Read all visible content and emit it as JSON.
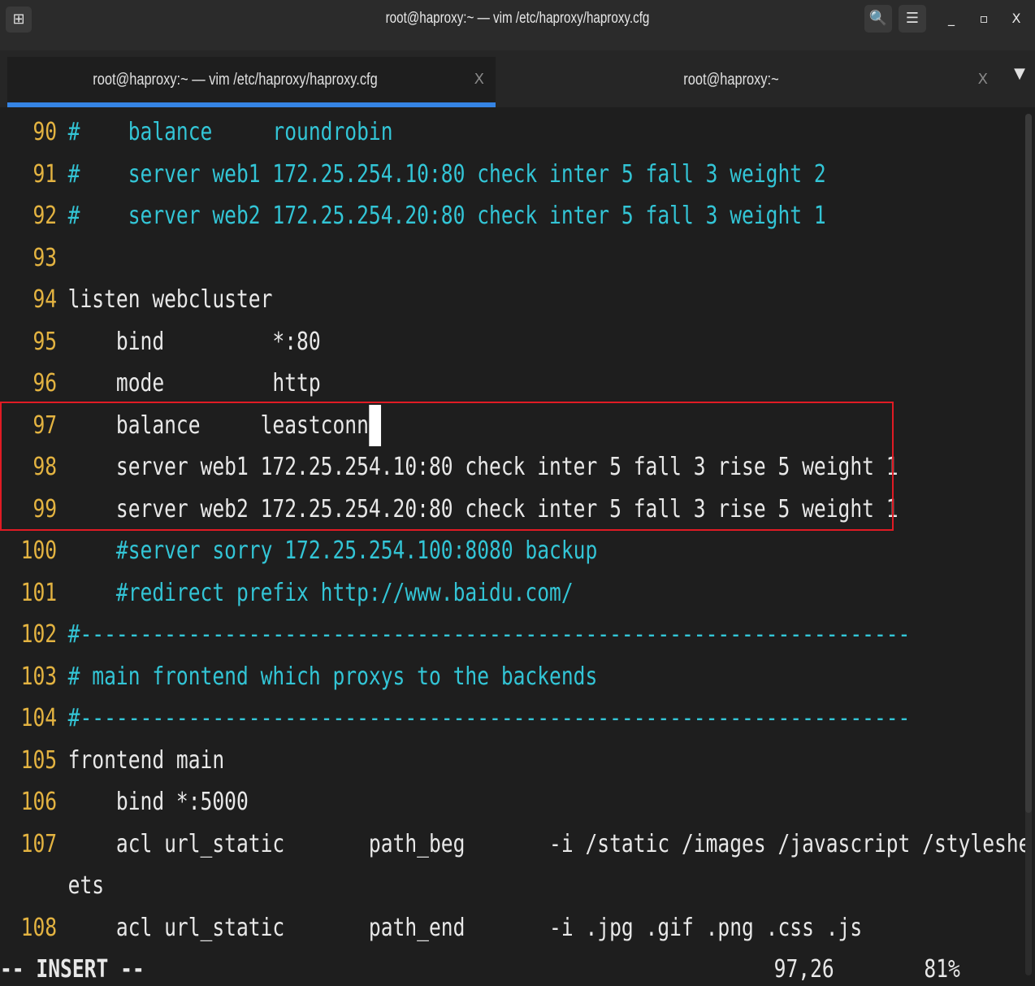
{
  "window": {
    "title": "root@haproxy:~ — vim /etc/haproxy/haproxy.cfg",
    "new_tab_icon": "⊞",
    "search_icon": "🔍",
    "menu_icon": "☰",
    "minimize_icon": "_",
    "maximize_icon": "▫",
    "close_icon": "X"
  },
  "tabs": [
    {
      "label": "root@haproxy:~ — vim /etc/haproxy/haproxy.cfg",
      "close": "X"
    },
    {
      "label": "root@haproxy:~",
      "close": "X"
    }
  ],
  "tab_menu_icon": "▼",
  "editor": {
    "lines": [
      {
        "num": "90",
        "text": "#    balance     roundrobin"
      },
      {
        "num": "91",
        "text": "#    server web1 172.25.254.10:80 check inter 5 fall 3 weight 2"
      },
      {
        "num": "92",
        "text": "#    server web2 172.25.254.20:80 check inter 5 fall 3 weight 1"
      },
      {
        "num": "93",
        "text": ""
      },
      {
        "num": "94",
        "text": "listen webcluster"
      },
      {
        "num": "95",
        "text": "    bind         *:80"
      },
      {
        "num": "96",
        "text": "    mode         http"
      },
      {
        "num": "97",
        "text": "    balance     leastconn"
      },
      {
        "num": "98",
        "text": "    server web1 172.25.254.10:80 check inter 5 fall 3 rise 5 weight 1"
      },
      {
        "num": "99",
        "text": "    server web2 172.25.254.20:80 check inter 5 fall 3 rise 5 weight 1"
      },
      {
        "num": "100",
        "text": "    #server sorry 172.25.254.100:8080 backup"
      },
      {
        "num": "101",
        "text": "    #redirect prefix http://www.baidu.com/"
      },
      {
        "num": "102",
        "text": "#---------------------------------------------------------------------"
      },
      {
        "num": "103",
        "text": "# main frontend which proxys to the backends"
      },
      {
        "num": "104",
        "text": "#---------------------------------------------------------------------"
      },
      {
        "num": "105",
        "text": "frontend main"
      },
      {
        "num": "106",
        "text": "    bind *:5000"
      },
      {
        "num": "107",
        "text": "    acl url_static       path_beg       -i /static /images /javascript /styleshe"
      },
      {
        "num": "",
        "text": "ets"
      },
      {
        "num": "108",
        "text": "    acl url_static       path_end       -i .jpg .gif .png .css .js"
      }
    ],
    "cursor_char": " ",
    "mode": "-- INSERT --",
    "position": "97,26",
    "percent": "81%"
  }
}
